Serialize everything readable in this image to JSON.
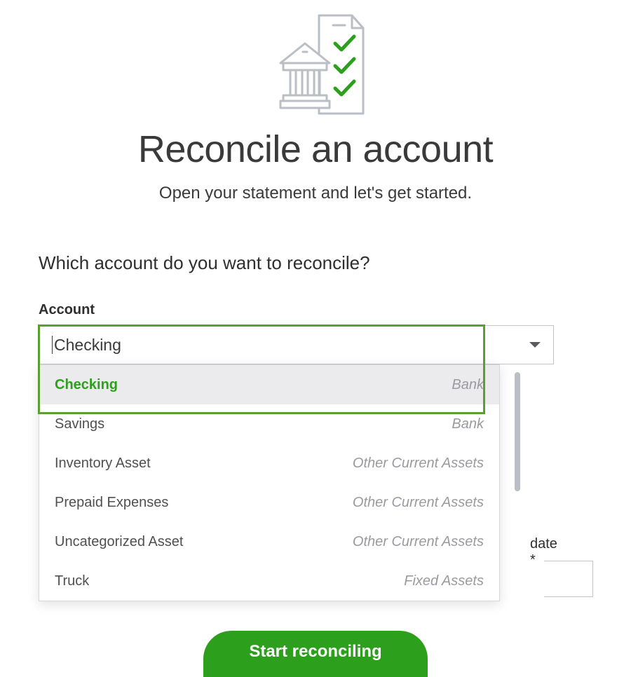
{
  "header": {
    "title": "Reconcile an account",
    "subtitle": "Open your statement and let's get started."
  },
  "main": {
    "question": "Which account do you want to reconcile?",
    "account_label": "Account",
    "selected_value": "Checking",
    "dropdown_options": [
      {
        "name": "Checking",
        "type": "Bank",
        "selected": true
      },
      {
        "name": "Savings",
        "type": "Bank",
        "selected": false
      },
      {
        "name": "Inventory Asset",
        "type": "Other Current Assets",
        "selected": false
      },
      {
        "name": "Prepaid Expenses",
        "type": "Other Current Assets",
        "selected": false
      },
      {
        "name": "Uncategorized Asset",
        "type": "Other Current Assets",
        "selected": false
      },
      {
        "name": "Truck",
        "type": "Fixed Assets",
        "selected": false
      }
    ],
    "partial_date_label": "date *",
    "start_button_label": "Start reconciling"
  },
  "colors": {
    "accent_green": "#2ca01c",
    "highlight_border": "#5c9e31"
  }
}
